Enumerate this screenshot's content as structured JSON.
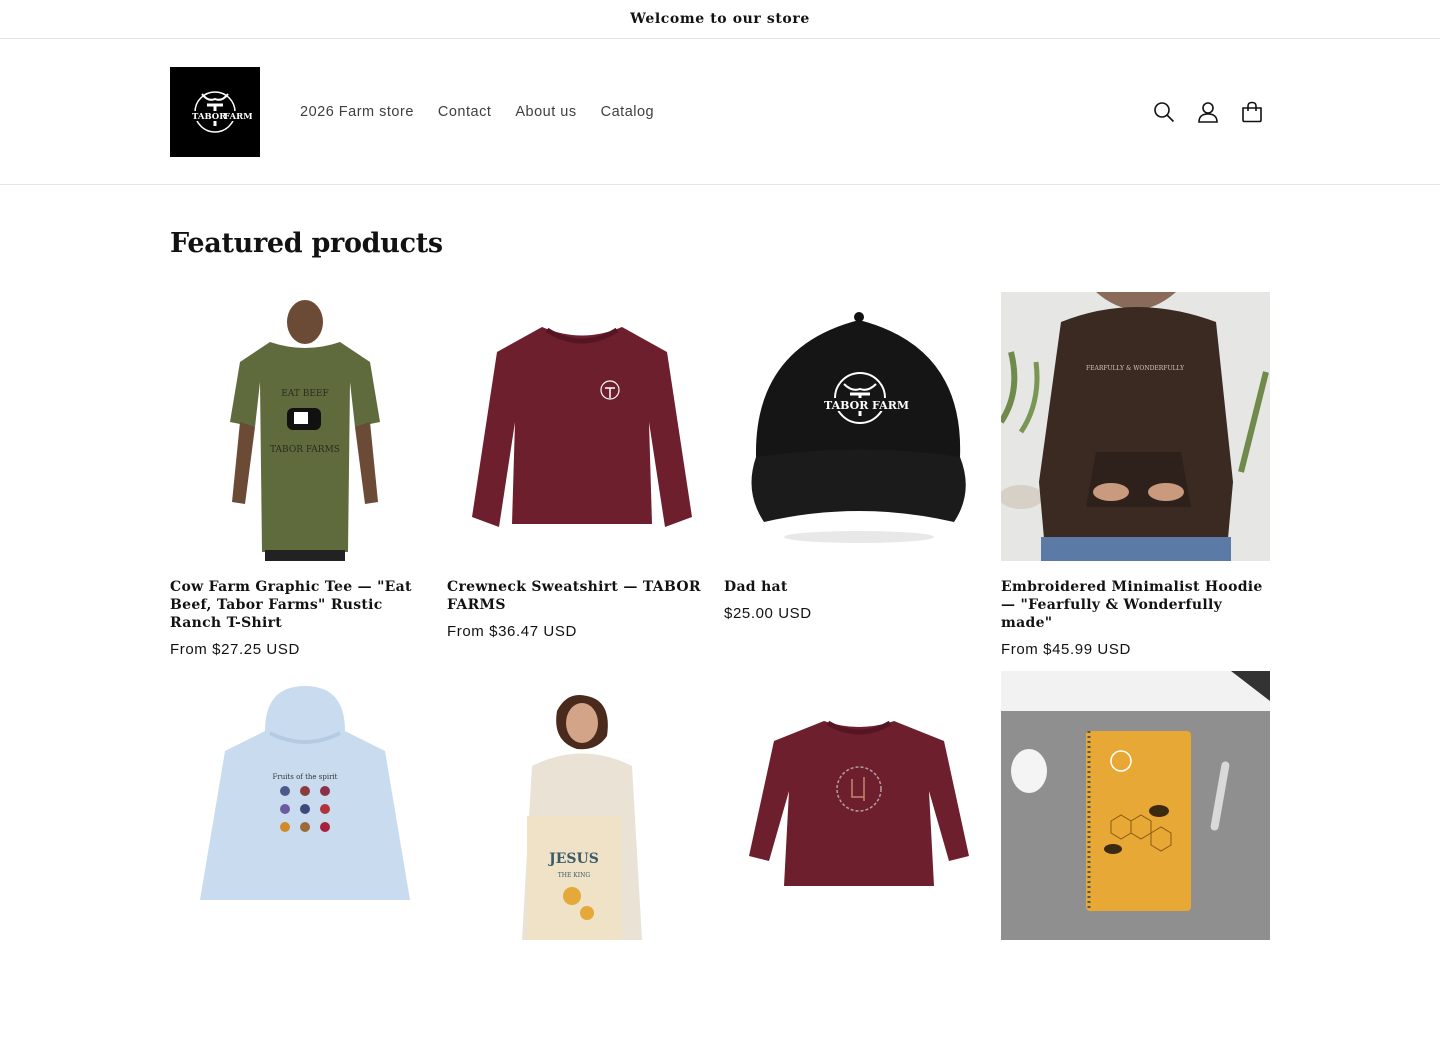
{
  "announcement": {
    "text": "Welcome to our store"
  },
  "header": {
    "logo": {
      "brand_left": "TABOR",
      "brand_right": "FARMS"
    },
    "nav": [
      {
        "label": "2026 Farm store"
      },
      {
        "label": "Contact"
      },
      {
        "label": "About us"
      },
      {
        "label": "Catalog"
      }
    ],
    "icons": [
      "search-icon",
      "account-icon",
      "cart-icon"
    ]
  },
  "section": {
    "title": "Featured products"
  },
  "products": [
    {
      "title": "Cow Farm Graphic Tee — \"Eat Beef, Tabor Farms\" Rustic Ranch T-Shirt",
      "price": "From $27.25 USD",
      "image_text_top": "EAT BEEF",
      "image_text_bottom": "TABOR FARMS"
    },
    {
      "title": "Crewneck Sweatshirt — TABOR FARMS",
      "price": "From $36.47 USD"
    },
    {
      "title": "Dad hat",
      "price": "$25.00 USD",
      "image_text_left": "TABOR",
      "image_text_right": "FARM"
    },
    {
      "title": "Embroidered Minimalist Hoodie — \"Fearfully & Wonderfully made\"",
      "price": "From $45.99 USD",
      "image_text": "FEARFULLY & WONDERFULLY"
    },
    {
      "title": "",
      "price": "",
      "image_text": "Fruits of the spirit"
    },
    {
      "title": "",
      "price": "",
      "image_text_top": "JESUS",
      "image_text_bottom": "THE KING"
    },
    {
      "title": "",
      "price": ""
    },
    {
      "title": "",
      "price": ""
    }
  ],
  "colors": {
    "olive": "#5f6b3c",
    "maroon": "#6e1f2d",
    "black": "#151515",
    "brown": "#3a2a22",
    "lightblue": "#c9dcef",
    "canvas": "#efe2c6",
    "notebook": "#e8a835"
  }
}
